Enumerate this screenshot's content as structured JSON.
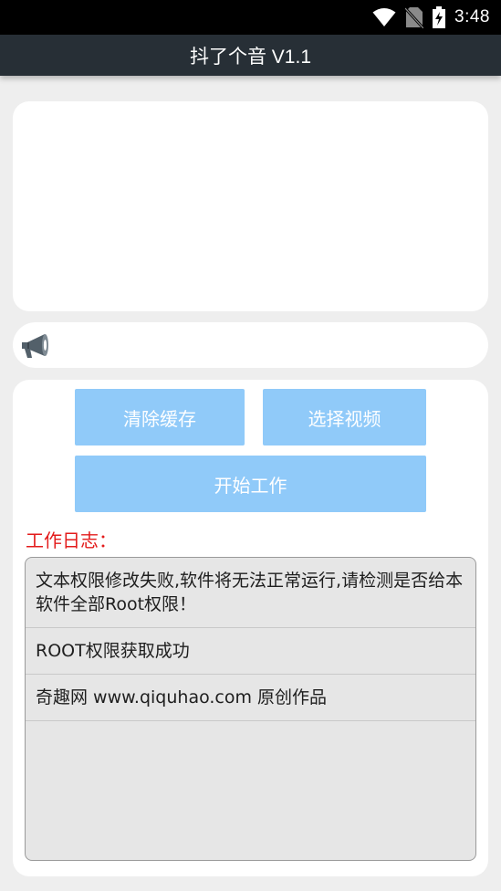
{
  "status_bar": {
    "time": "3:48",
    "icons": [
      "wifi-icon",
      "no-sim-icon",
      "battery-charging-icon"
    ]
  },
  "app_bar": {
    "title": "抖了个音 V1.1"
  },
  "notice": {
    "icon": "megaphone-icon",
    "text": ""
  },
  "buttons": {
    "clear_cache": "清除缓存",
    "select_video": "选择视频",
    "start_work": "开始工作"
  },
  "log": {
    "title": "工作日志：",
    "items": [
      "文本权限修改失败,软件将无法正常运行,请检测是否给本软件全部Root权限！",
      "ROOT权限获取成功",
      "奇趣网 www.qiquhao.com 原创作品"
    ]
  },
  "colors": {
    "button_bg": "#90caf9",
    "app_bar_bg": "#272f36",
    "log_title": "#e31b1b"
  }
}
